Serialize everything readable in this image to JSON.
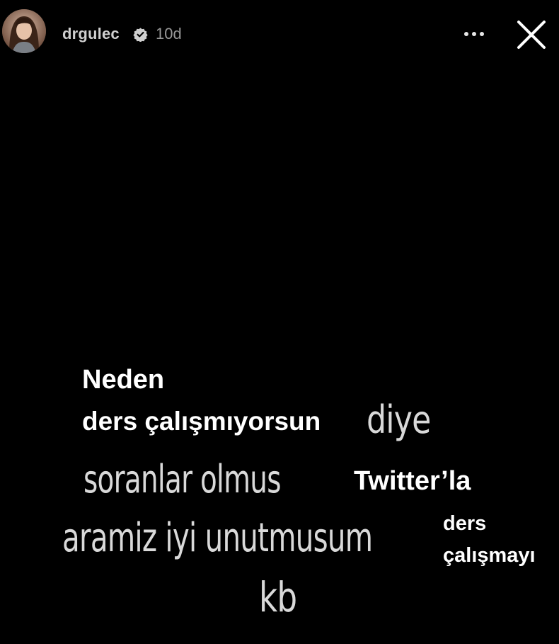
{
  "header": {
    "username": "drgulec",
    "time": "10d",
    "verified": true,
    "more_icon": "more-horizontal-icon",
    "close_icon": "close-icon"
  },
  "story": {
    "overlay_line1": "Neden",
    "overlay_line2": "ders çalışmıyorsun",
    "original_line1": "diye",
    "original_line2": "soranlar olmus",
    "overlay_twitter": "Twitter’la",
    "original_line3": "aramiz iyi unutmusum",
    "overlay_ders": "ders",
    "overlay_calismayi": "çalışmayı",
    "original_line4": "kb"
  }
}
